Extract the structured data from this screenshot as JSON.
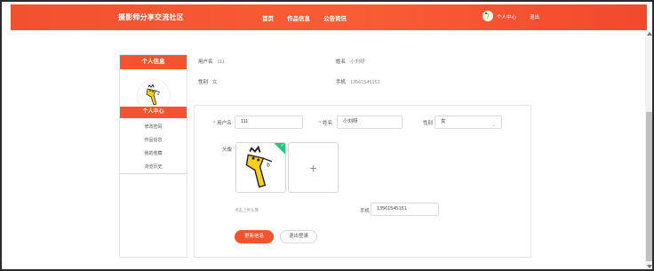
{
  "header": {
    "brand": "摄影师分享交流社区",
    "nav": [
      "首页",
      "作品信息",
      "公告资讯"
    ],
    "user_center": "个人中心",
    "logout": "退出"
  },
  "sidebar": {
    "title": "个人信息",
    "menu_head": "个人中心",
    "items": [
      "修改密码",
      "作品信息",
      "我的收藏",
      "浏览历史"
    ]
  },
  "info": {
    "username_label": "用户名",
    "username_value": "111",
    "name_label": "姓名",
    "name_value": "小刘呀",
    "gender_label": "性别",
    "gender_value": "女",
    "phone_label": "手机",
    "phone_value": "13561545151"
  },
  "form": {
    "username_label": "用户名",
    "username_value": "111",
    "name_label": "姓名",
    "name_value": "小刘呀",
    "gender_label": "性别",
    "gender_value": "女",
    "avatar_label": "头像",
    "upload_hint": "点击上传头像",
    "phone_label": "手机",
    "phone_value": "13561545151",
    "required_mark": "*",
    "upload_plus": "+",
    "select_chevron": "⌄",
    "upload_check": "✓"
  },
  "buttons": {
    "save": "更新信息",
    "logout": "退出登录"
  },
  "colors": {
    "accent": "#f3542f",
    "upload_success": "#24c77a"
  }
}
